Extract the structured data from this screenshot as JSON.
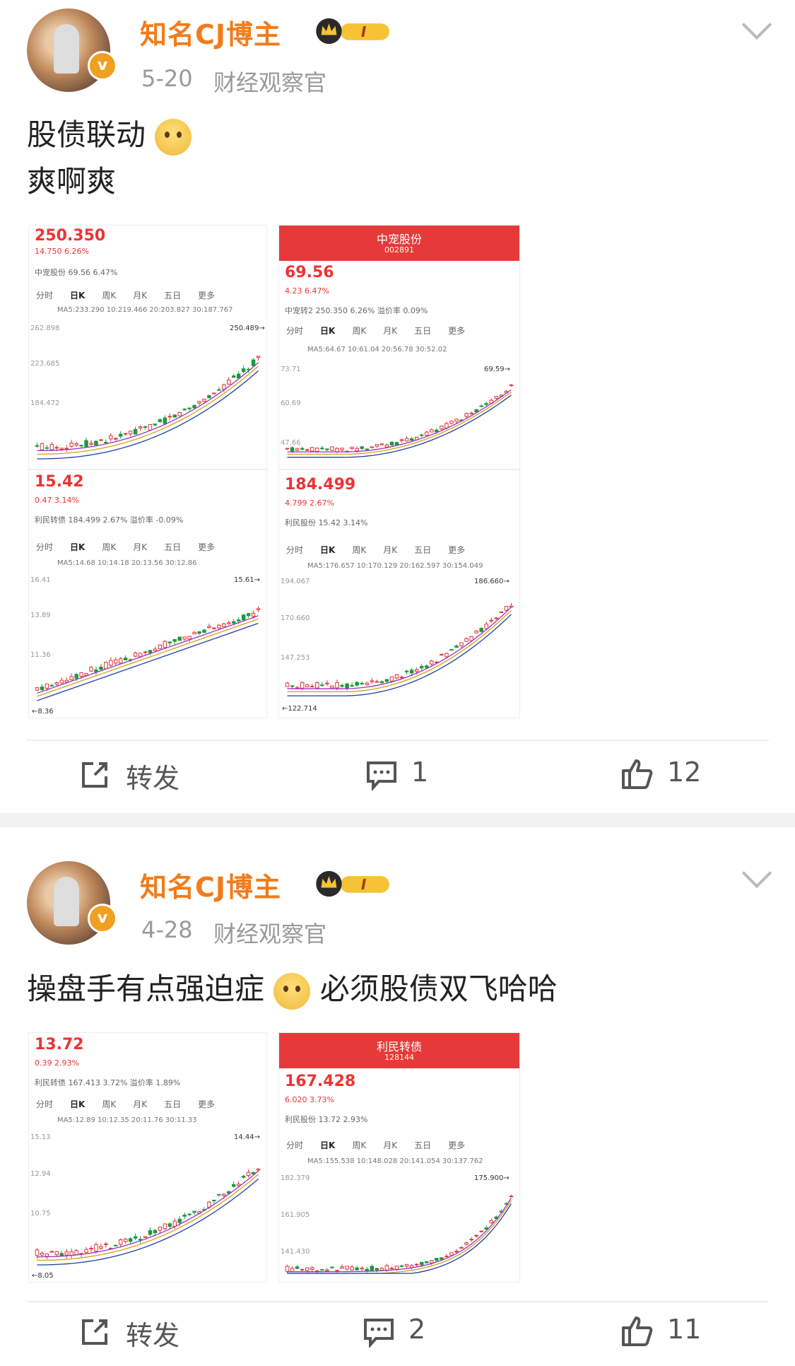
{
  "posts": [
    {
      "author": "知名CJ博主",
      "level_badge": "I",
      "date": "5-20",
      "source": "财经观察官",
      "text_line1": "股债联动",
      "text_line2": "爽啊爽",
      "shots": [
        {
          "price": "250.350",
          "change": "14.750 6.26%",
          "name_line": "中宠股份 69.56 6.47%",
          "top_label": "250.489→",
          "ma": "MA5:233.290 10:219.466 20:203.827 30:187.767",
          "y_top": "262.898",
          "y_mid": "223.685",
          "y_low": "184.472"
        },
        {
          "title": "中宠股份",
          "code": "002891",
          "price": "69.56",
          "change": "4.23 6.47%",
          "name_line": "中宠转2 250.350 6.26% 溢价率 0.09%",
          "top_label": "69.59→",
          "ma": "MA5:64.67 10:61.04 20:56.78 30:52.02",
          "y_top": "73.71",
          "y_mid": "60.69",
          "y_low": "47.66"
        },
        {
          "price": "15.42",
          "change": "0.47 3.14%",
          "name_line": "利民转债 184.499 2.67% 溢价率 -0.09%",
          "top_label": "15.61→",
          "ma": "MA5:14.68 10:14.18 20:13.56 30:12.86",
          "y_top": "16.41",
          "y_mid": "13.89",
          "y_low": "11.36",
          "bottom": "←8.36"
        },
        {
          "price": "184.499",
          "change": "4.799 2.67%",
          "name_line": "利民股份 15.42 3.14%",
          "top_label": "186.660→",
          "ma": "MA5:176.657 10:170.129 20:162.597 30:154.049",
          "y_top": "194.067",
          "y_mid": "170.660",
          "y_low": "147.253",
          "bottom": "←122.714"
        }
      ],
      "repost_label": "转发",
      "comments": "1",
      "likes": "12"
    },
    {
      "author": "知名CJ博主",
      "level_badge": "I",
      "date": "4-28",
      "source": "财经观察官",
      "text_a": "操盘手有点强迫症",
      "text_b": "必须股债双飞哈哈",
      "shots": [
        {
          "price": "13.72",
          "change": "0.39 2.93%",
          "name_line": "利民转债 167.413 3.72% 溢价率 1.89%",
          "top_label": "14.44→",
          "ma": "MA5:12.89 10:12.35 20:11.76 30:11.33",
          "y_top": "15.13",
          "y_mid": "12.94",
          "y_low": "10.75",
          "bottom": "←8.05"
        },
        {
          "title": "利民转债",
          "code": "128144",
          "price": "167.428",
          "change": "6.020 3.73%",
          "name_line": "利民股份 13.72 2.93%",
          "top_label": "175.900→",
          "ma": "MA5:155.538 10:148.028 20:141.054 30:137.762",
          "y_top": "182.379",
          "y_mid": "161.905",
          "y_low": "141.430"
        }
      ],
      "repost_label": "转发",
      "comments": "2",
      "likes": "11"
    }
  ],
  "chart_tabs": [
    "分时",
    "日K",
    "周K",
    "月K",
    "五日",
    "更多"
  ],
  "colors": {
    "brand": "#f07c1c",
    "up": "#e33333",
    "down": "#1a9a3a",
    "header": "#e63a3a"
  },
  "icons": [
    "v-verified-icon",
    "crown-badge-icon",
    "chevron-down-icon",
    "repost-icon",
    "comment-icon",
    "like-icon",
    "back-icon",
    "search-icon"
  ]
}
